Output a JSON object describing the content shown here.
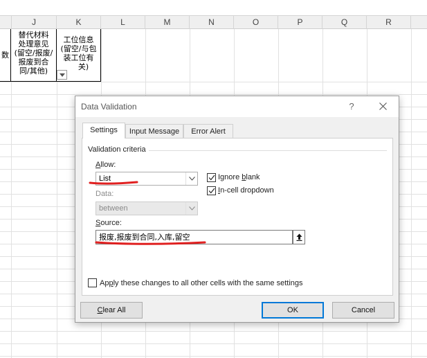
{
  "columns": [
    "J",
    "K",
    "L",
    "M",
    "N",
    "O",
    "P",
    "Q",
    "R"
  ],
  "cells": {
    "i_partial": "数",
    "j_header": [
      "替代材料",
      "处理意见",
      "(留空/报废/",
      "报废到合",
      "同/其他)"
    ],
    "k_header": [
      "工位信息",
      "(留空/与包",
      "装工位有",
      "关)"
    ]
  },
  "dialog": {
    "title": "Data Validation",
    "help": "?",
    "tabs": [
      "Settings",
      "Input Message",
      "Error Alert"
    ],
    "group_label": "Validation criteria",
    "allow": {
      "prefix": "",
      "key": "A",
      "rest": "llow:",
      "value": "List"
    },
    "data": {
      "label": "Data:",
      "value": "between"
    },
    "ignore_blank": {
      "prefix": "Ignore ",
      "key": "b",
      "rest": "lank",
      "checked": true
    },
    "in_cell_dropdown": {
      "prefix": "",
      "key": "I",
      "rest": "n-cell dropdown",
      "checked": true
    },
    "source": {
      "prefix": "",
      "key": "S",
      "rest": "ource:",
      "value": "报废,报废到合同,入库,留空"
    },
    "apply_all": {
      "prefix": "Ap",
      "key": "p",
      "rest": "ly these changes to all other cells with the same settings",
      "checked": false
    },
    "buttons": {
      "clear_all": {
        "prefix": "",
        "key": "C",
        "rest": "lear All"
      },
      "ok": "OK",
      "cancel": "Cancel"
    }
  },
  "colors": {
    "annotation_red": "#e02020",
    "default_button_border": "#0078d7"
  },
  "icons": [
    "filter-dropdown-icon",
    "close-icon",
    "chevron-down-icon",
    "collapse-dialog-icon",
    "checkmark-icon"
  ]
}
